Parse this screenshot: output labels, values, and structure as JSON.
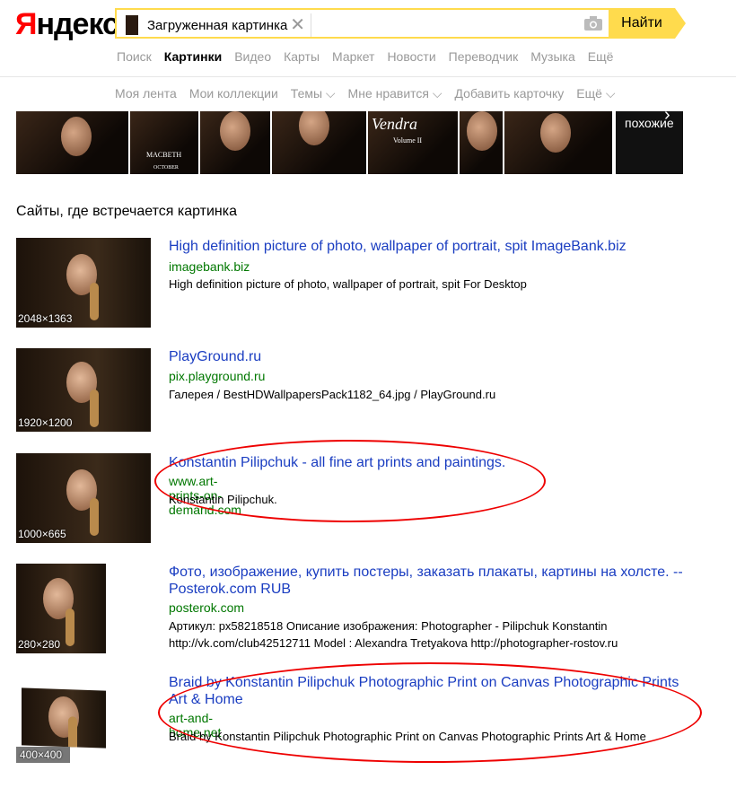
{
  "logo": {
    "first": "Я",
    "rest": "ндекс"
  },
  "search": {
    "chip_label": "Загруженная картинка",
    "button": "Найти"
  },
  "tabs": [
    "Поиск",
    "Картинки",
    "Видео",
    "Карты",
    "Маркет",
    "Новости",
    "Переводчик",
    "Музыка",
    "Ещё"
  ],
  "subnav": [
    "Моя лента",
    "Мои коллекции",
    "Темы ⌵",
    "Мне нравится ⌵",
    "Добавить карточку",
    "Ещё ⌵"
  ],
  "strip": {
    "macbeth": "MACBETH",
    "october": "OCTOBER",
    "vendra": "Vendra",
    "volume": "Volume II",
    "more": "похожие"
  },
  "section_title": "Сайты, где встречается картинка",
  "results": [
    {
      "size": "2048×1363",
      "title": "High definition picture of photo, wallpaper of portrait, spit ImageBank.biz",
      "url": "imagebank.biz",
      "desc": "High definition picture of photo, wallpaper of portrait, spit For Desktop"
    },
    {
      "size": "1920×1200",
      "title": "PlayGround.ru",
      "url": "pix.playground.ru",
      "desc": "Галерея / BestHDWallpapersPack1182_64.jpg / PlayGround.ru"
    },
    {
      "size": "1000×665",
      "title": "Konstantin Pilipchuk - all fine art prints and paintings.",
      "url": "www.art-prints-on-demand.com",
      "desc": "Konstantin Pilipchuk."
    },
    {
      "size": "280×280",
      "title": "Фото, изображение, купить постеры, заказать плакаты, картины на холсте. -- Posterok.com RUB",
      "url": "posterok.com",
      "desc": "Артикул: px58218518 Описание изображения: Photographer - Pilipchuk Konstantin http://vk.com/club42512711 Model : Alexandra Tretyakova http://photographer-rostov.ru"
    },
    {
      "size": "400×400",
      "title": "Braid by Konstantin Pilipchuk Photographic Print on Canvas Photographic Prints Art & Home",
      "url": "art-and-home.net",
      "desc": "Braid by Konstantin Pilipchuk Photographic Print on Canvas Photographic Prints Art & Home"
    }
  ]
}
